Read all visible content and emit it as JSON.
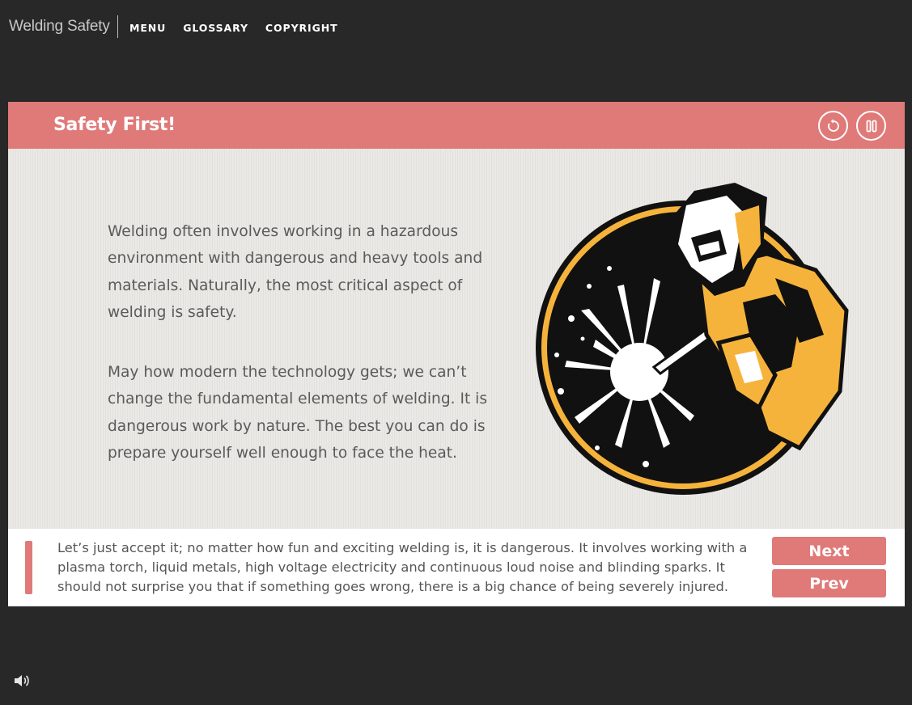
{
  "app": {
    "title": "Welding Safety"
  },
  "nav": {
    "items": [
      "MENU",
      "GLOSSARY",
      "COPYRIGHT"
    ]
  },
  "slide": {
    "title": "Safety First!",
    "paragraphs": [
      "Welding often involves working in a hazardous environment with dangerous and heavy tools and materials. Naturally, the most critical aspect of welding is safety.",
      "May how modern the technology gets; we can’t change the fundamental elements of welding. It is dangerous work by nature. The best you can do is prepare yourself well enough to face the heat."
    ],
    "illustration_icon": "welder-icon"
  },
  "controls": {
    "replay_icon": "replay-icon",
    "pause_icon": "pause-icon",
    "volume_icon": "volume-icon"
  },
  "footer": {
    "narration": "Let’s just accept it; no matter how fun and exciting welding is, it is dangerous. It involves working with a plasma torch, liquid metals, high voltage electricity and continuous loud noise and blinding sparks. It should not surprise you that if something goes wrong, there is a big chance of being severely injured.",
    "next_label": "Next",
    "prev_label": "Prev"
  },
  "colors": {
    "background": "#282828",
    "accent": "#df7a79",
    "content_bg": "#ebe9e5",
    "illustration_orange": "#f6b33c",
    "illustration_black": "#111111"
  }
}
